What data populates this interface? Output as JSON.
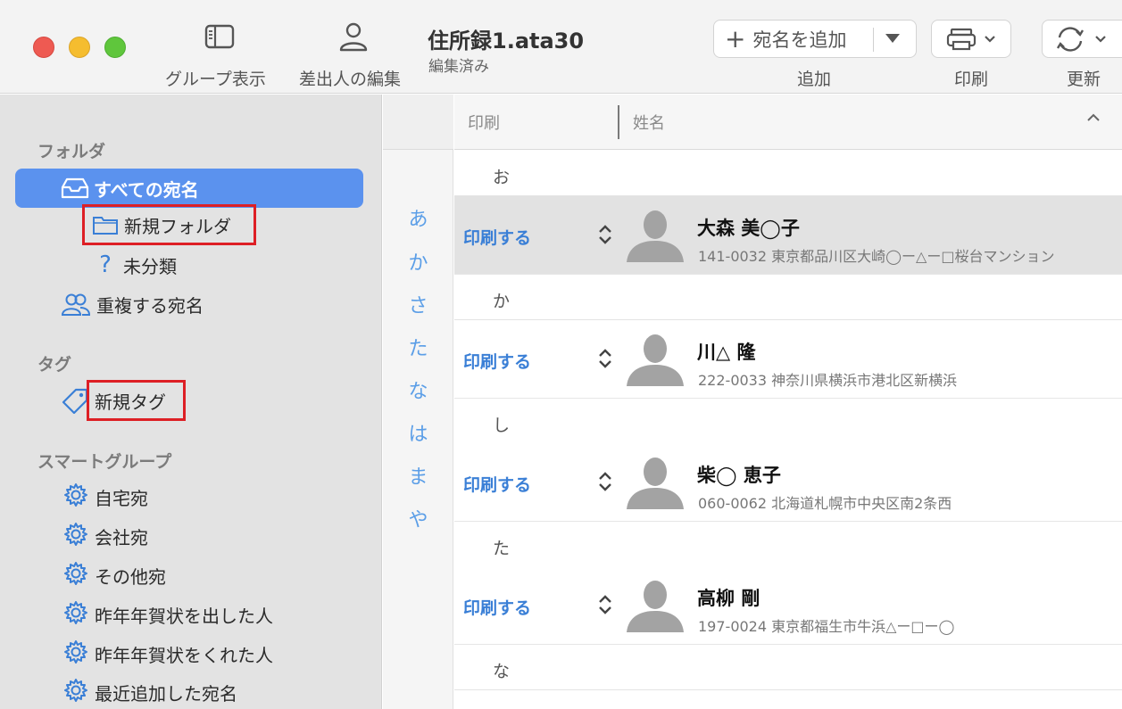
{
  "toolbar": {
    "group_view_label": "グループ表示",
    "sender_edit_label": "差出人の編集",
    "document_title": "住所録1.ata30",
    "document_status": "編集済み",
    "add_button_label": "宛名を追加",
    "add_label": "追加",
    "print_label": "印刷",
    "update_label": "更新"
  },
  "sidebar": {
    "folder_section": "フォルダ",
    "all_addresses": "すべての宛名",
    "new_folder": "新規フォルダ",
    "uncategorized": "未分類",
    "duplicates": "重複する宛名",
    "tag_section": "タグ",
    "new_tag": "新規タグ",
    "smart_section": "スマートグループ",
    "smart_groups": [
      "自宅宛",
      "会社宛",
      "その他宛",
      "昨年年賀状を出した人",
      "昨年年賀状をくれた人",
      "最近追加した宛名"
    ]
  },
  "index": [
    "あ",
    "か",
    "さ",
    "た",
    "な",
    "は",
    "ま",
    "や"
  ],
  "list": {
    "col_print": "印刷",
    "col_name": "姓名",
    "groups": [
      "お",
      "か",
      "し",
      "た",
      "な"
    ],
    "rows": [
      {
        "print": "印刷する",
        "name": "大森 美◯子",
        "address": "141-0032 東京都品川区大崎◯ー△ー□桜台マンション",
        "selected": true
      },
      {
        "print": "印刷する",
        "name": "川△ 隆",
        "address": "222-0033 神奈川県横浜市港北区新横浜",
        "selected": false
      },
      {
        "print": "印刷する",
        "name": "柴◯ 恵子",
        "address": "060-0062 北海道札幌市中央区南2条西",
        "selected": false
      },
      {
        "print": "印刷する",
        "name": "高柳 剛",
        "address": "197-0024 東京都福生市牛浜△ー□ー◯",
        "selected": false
      }
    ]
  },
  "colors": {
    "accent": "#5b92ee",
    "highlight_border": "#dd1f25",
    "link_blue": "#3a7fd6"
  }
}
